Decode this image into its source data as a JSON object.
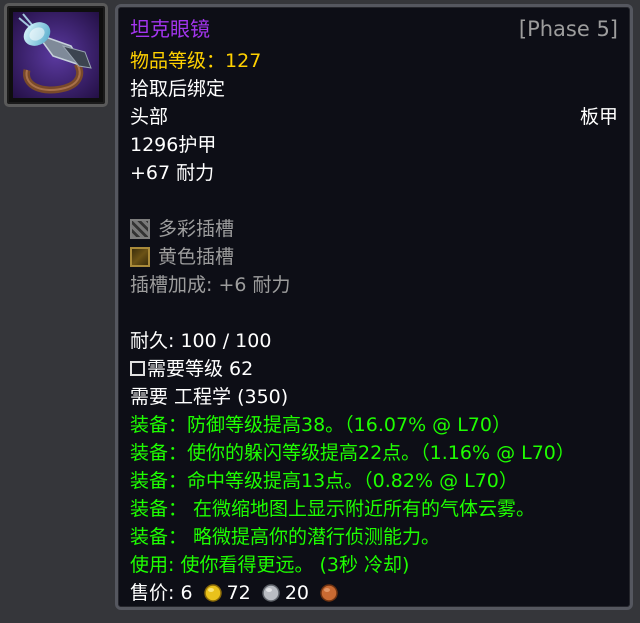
{
  "item": {
    "name": "坦克眼镜",
    "phase": "[Phase 5]",
    "item_level_label": "物品等级：",
    "item_level_value": "127",
    "binding": "拾取后绑定",
    "slot": "头部",
    "armor_type": "板甲",
    "armor": "1296护甲",
    "stat": "+67 耐力",
    "sockets": [
      {
        "label": "多彩插槽",
        "icon": "meta-socket-icon"
      },
      {
        "label": "黄色插槽",
        "icon": "yellow-socket-icon"
      }
    ],
    "socket_bonus": "插槽加成: +6 耐力",
    "durability": "耐久: 100 / 100",
    "required_level": "需要等级 62",
    "required_profession": "需要 工程学 (350)",
    "effects": [
      "装备：防御等级提高38。（16.07% @ L70）",
      "装备：使你的躲闪等级提高22点。（1.16% @ L70）",
      "装备：命中等级提高13点。（0.82% @ L70）",
      "装备：  在微缩地图上显示附近所有的气体云雾。",
      "装备：  略微提高你的潜行侦测能力。",
      "使用: 使你看得更远。 (3秒 冷却)"
    ],
    "sell_price": {
      "label": "售价: ",
      "gold": "6",
      "silver": "72",
      "copper": "20"
    }
  },
  "colors": {
    "epic": "#a335ee",
    "item_level": "#ffd100",
    "green_text": "#1eff00",
    "grey_text": "#9d9d9d"
  }
}
